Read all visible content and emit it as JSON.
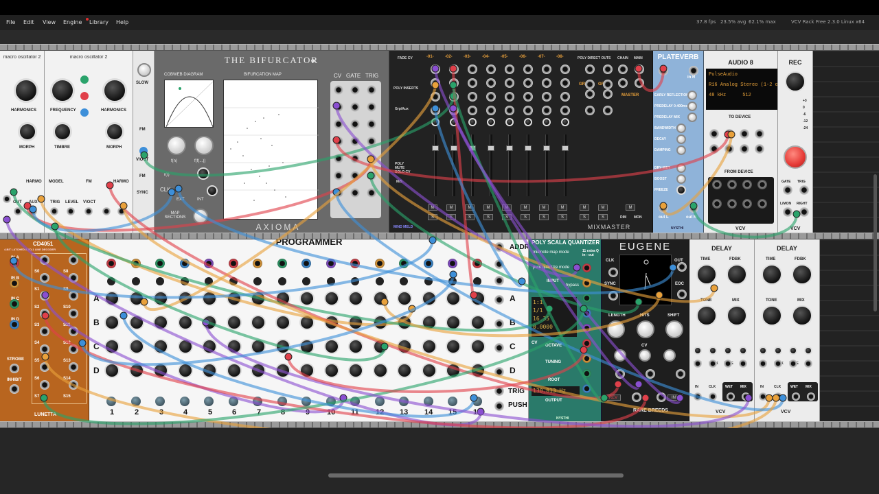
{
  "menu": [
    "File",
    "Edit",
    "View",
    "Engine",
    "Library",
    "Help"
  ],
  "status": {
    "fps": "37.8 fps",
    "avg": "23.5% avg",
    "max": "62.1% max",
    "version": "VCV Rack Free 2.3.0 Linux x64"
  },
  "colors": {
    "rack_bg": "#262626",
    "cable_red": "#e0404a",
    "cable_orange": "#e9a13b",
    "cable_green": "#2aa36b",
    "cable_blue": "#3d8fd9",
    "cable_purple": "#8a4fd1",
    "programmer_orange": "#e47b1f",
    "plateverb_blue": "#8fb3d9"
  },
  "macro": {
    "title1": "macro oscillator 2",
    "title2": "macro oscillator 2",
    "harmonics": "HARMONICS",
    "frequency": "FREQUENCY",
    "harmonics2": "HARMONICS",
    "morph": "MORPH",
    "timbre": "TIMBRE",
    "morph2": "MORPH",
    "harmo": "HARMO",
    "model": "MODEL",
    "fm": "FM",
    "harmo2": "HARMO",
    "trig": "TRIG",
    "level": "LEVEL",
    "voct": "V/OCT",
    "out": "OUT",
    "aux": "AUX"
  },
  "lfo": {
    "slow": "SLOW",
    "fm": "FM",
    "voct": "V/OCT",
    "fm2": "FM",
    "sync": "SYNC"
  },
  "bifurcator": {
    "title": "THE BIFURCATOR",
    "cobweb": "COBWEB DIAGRAM",
    "map": "BIFURCATION MAP",
    "fn": "f(n)",
    "ffn": "f(f(...))",
    "rt": "r(t)",
    "clk": "CLK",
    "ext": "EXT",
    "int": "INT",
    "map_sections": "MAP SECTIONS",
    "cv": "CV",
    "gate": "GATE",
    "trig": "TRIG",
    "brand": "AXIOMA"
  },
  "mixmaster": {
    "fade_cv": "FADE CV",
    "poly_inserts": "POLY INSERTS",
    "grp_aux": "Grp/Aux",
    "poly_mute": "POLY MUTE SOLO CV",
    "ms": "M/S",
    "tracks": [
      "-01-",
      "-02-",
      "-03-",
      "-04-",
      "-05-",
      "-06-",
      "-07-",
      "-08-"
    ],
    "poly_direct": "POLY DIRECT OUTS",
    "grp1": "GRP1",
    "grp2": "GRP2",
    "chain": "CHAIN",
    "main": "MAIN",
    "master": "MASTER",
    "dim": "DIM",
    "mon": "MON",
    "brand": "MIXMASTER",
    "brand2": "MIND MELD",
    "m": "M",
    "s": "S"
  },
  "plateverb": {
    "title": "PLATEVERB",
    "in_r": "in R",
    "early": "EARLY REFLECTIONS",
    "predelay": "PREDELAY 0-400ms",
    "predelay_mix": "PREDELAY MIX",
    "bandwidth": "BANDWIDTH",
    "decay": "DECAY",
    "damping": "DAMPING",
    "drywet": "DRY-WET",
    "boost": "BOOST",
    "freeze": "FREEZE",
    "out_l": "out L",
    "out_r": "out R",
    "brand": "NYSTHI"
  },
  "audio8": {
    "title": "AUDIO 8",
    "driver": "PulseAudio",
    "device": "R16 Analog Stereo (1-2 ou",
    "rate": "48 kHz",
    "block": "512",
    "to_device": "TO DEVICE",
    "from_device": "FROM DEVICE",
    "brand": "VCV"
  },
  "rec": {
    "title": "REC",
    "gate": "GATE",
    "trig": "TRIG",
    "lmon": "L/MON",
    "right": "RIGHT",
    "brand": "VCV",
    "db": [
      "+3",
      "0",
      "-6",
      "-12",
      "-24"
    ]
  },
  "cd4051": {
    "title": "CD4051",
    "sub": "4-BIT LATCHED 8-TO-1 LINE DECODER",
    "ina": "IN A",
    "inb": "IN B",
    "inc": "IN C",
    "ind": "IN D",
    "strobe": "STROBE",
    "inhibit": "INHIBIT",
    "brand": "LUNETTA",
    "s_left": [
      "S0",
      "S1",
      "S2",
      "S3",
      "S4",
      "S5",
      "S6",
      "S7"
    ],
    "s_right": [
      "S8",
      "S9",
      "S10",
      "S11",
      "S12",
      "S13",
      "S14",
      "S15"
    ]
  },
  "programmer": {
    "title": "PROGRAMMER",
    "addr": "ADDR",
    "rows": [
      "A",
      "B",
      "C",
      "D"
    ],
    "trig": "TRIG",
    "push": "PUSH",
    "steps": [
      "1",
      "2",
      "3",
      "4",
      "5",
      "6",
      "7",
      "8",
      "9",
      "10",
      "11",
      "12",
      "13",
      "14",
      "15",
      "16"
    ]
  },
  "quantizer": {
    "title": "POLY SCALA QUANTIZER",
    "midinote": "midinote map mode",
    "pure": "pure quantize mode",
    "input": "INPUT",
    "bypass": "bypass",
    "lcd": [
      "1:1",
      "1/1",
      "16.35",
      "0.0000"
    ],
    "cv": "CV",
    "octave": "OCTAVE",
    "tuning": "TUNING",
    "root": "ROOT",
    "output": "OUTPUT",
    "freq": "130.813 Hz",
    "extra": "11 extra Q in - out",
    "brand": "NYSTHI"
  },
  "eugene": {
    "title": "EUGENE",
    "clk": "CLK",
    "sync": "SYNC",
    "out": "OUT",
    "eoc": "EOC",
    "length": "LENGTH",
    "hits": "HITS",
    "shift": "SHIFT",
    "cv": "CV",
    "rev": "REV",
    "inv": "INV",
    "brand": "RARE BREEDS"
  },
  "delay1": {
    "title": "DELAY",
    "time": "TIME",
    "fdbk": "FDBK",
    "tone": "TONE",
    "mix": "MIX",
    "in": "IN",
    "clk": "CLK",
    "wet": "WET",
    "mix_out": "MIX",
    "brand": "VCV"
  },
  "delay2": {
    "title": "DELAY",
    "time": "TIME",
    "fdbk": "FDBK",
    "tone": "TONE",
    "mix": "MIX",
    "in": "IN",
    "clk": "CLK",
    "wet": "WET",
    "mix_out": "MIX",
    "brand": "VCV"
  }
}
